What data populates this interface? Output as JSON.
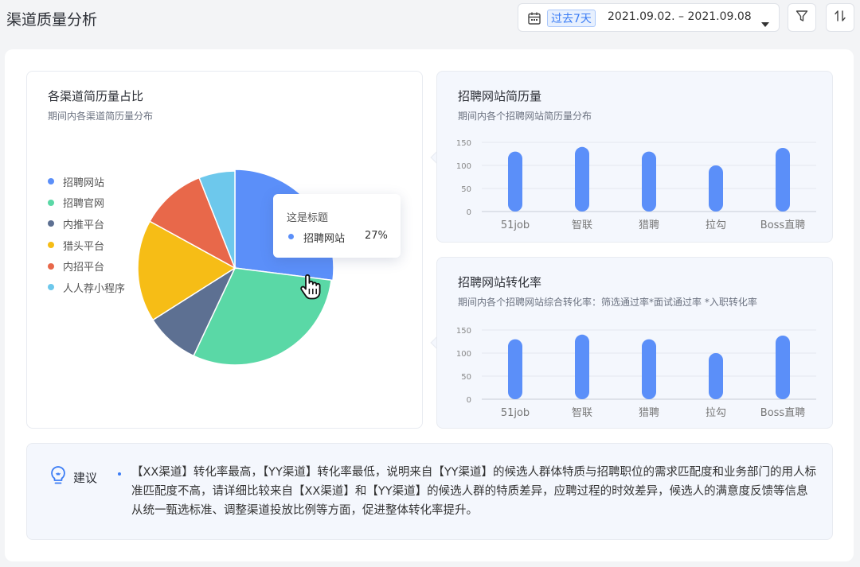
{
  "page": {
    "title": "渠道质量分析"
  },
  "header": {
    "range_chip": "过去7天",
    "range_text": "2021.09.02. – 2021.09.08",
    "icons": {
      "calendar": "calendar-icon",
      "caret": "caret-down-icon",
      "filter": "filter-icon",
      "sort": "sort-icon"
    }
  },
  "pie_card": {
    "title": "各渠道简历量占比",
    "subtitle": "期间内各渠道简历量分布",
    "legend": [
      {
        "label": "招聘网站",
        "color": "#5b8ff9"
      },
      {
        "label": "招聘官网",
        "color": "#5ad8a6"
      },
      {
        "label": "内推平台",
        "color": "#5d7092"
      },
      {
        "label": "猎头平台",
        "color": "#f6bd16"
      },
      {
        "label": "内招平台",
        "color": "#e8684a"
      },
      {
        "label": "人人荐小程序",
        "color": "#6dc8ec"
      }
    ],
    "tooltip": {
      "title": "这是标题",
      "name": "招聘网站",
      "value": "27%",
      "color": "#5b8ff9"
    }
  },
  "site_card": {
    "title": "招聘网站简历量",
    "subtitle": "期间内各个招聘网站简历量分布"
  },
  "conv_card": {
    "title": "招聘网站转化率",
    "subtitle": "期间内各个招聘网站综合转化率：筛选通过率*面试通过率 *入职转化率"
  },
  "suggestion": {
    "label": "建议",
    "text": "【XX渠道】转化率最高，【YY渠道】转化率最低，说明来自【YY渠道】的候选人群体特质与招聘职位的需求匹配度和业务部门的用人标准匹配度不高，请详细比较来自【XX渠道】和【YY渠道】的候选人群的特质差异，应聘过程的时效差异，候选人的满意度反馈等信息从统一甄选标准、调整渠道投放比例等方面，促进整体转化率提升。"
  },
  "chart_data": [
    {
      "type": "pie",
      "title": "各渠道简历量占比",
      "categories": [
        "招聘网站",
        "招聘官网",
        "内推平台",
        "猎头平台",
        "内招平台",
        "人人荐小程序"
      ],
      "values": [
        27,
        30,
        9,
        17,
        11,
        6
      ],
      "colors": [
        "#5b8ff9",
        "#5ad8a6",
        "#5d7092",
        "#f6bd16",
        "#e8684a",
        "#6dc8ec"
      ],
      "highlight": "招聘网站",
      "legend": "left"
    },
    {
      "type": "bar",
      "title": "招聘网站简历量",
      "categories": [
        "51job",
        "智联",
        "猎聘",
        "拉勾",
        "Boss直聘"
      ],
      "values": [
        130,
        140,
        130,
        100,
        138
      ],
      "yticks": [
        0,
        50,
        100,
        150
      ],
      "ylim": [
        0,
        150
      ],
      "color": "#5b8ff9",
      "grid": true
    },
    {
      "type": "bar",
      "title": "招聘网站转化率",
      "categories": [
        "51job",
        "智联",
        "猎聘",
        "拉勾",
        "Boss直聘"
      ],
      "values": [
        130,
        140,
        130,
        100,
        138
      ],
      "yticks": [
        0,
        50,
        100,
        150
      ],
      "ylim": [
        0,
        150
      ],
      "color": "#5b8ff9",
      "grid": true
    }
  ]
}
